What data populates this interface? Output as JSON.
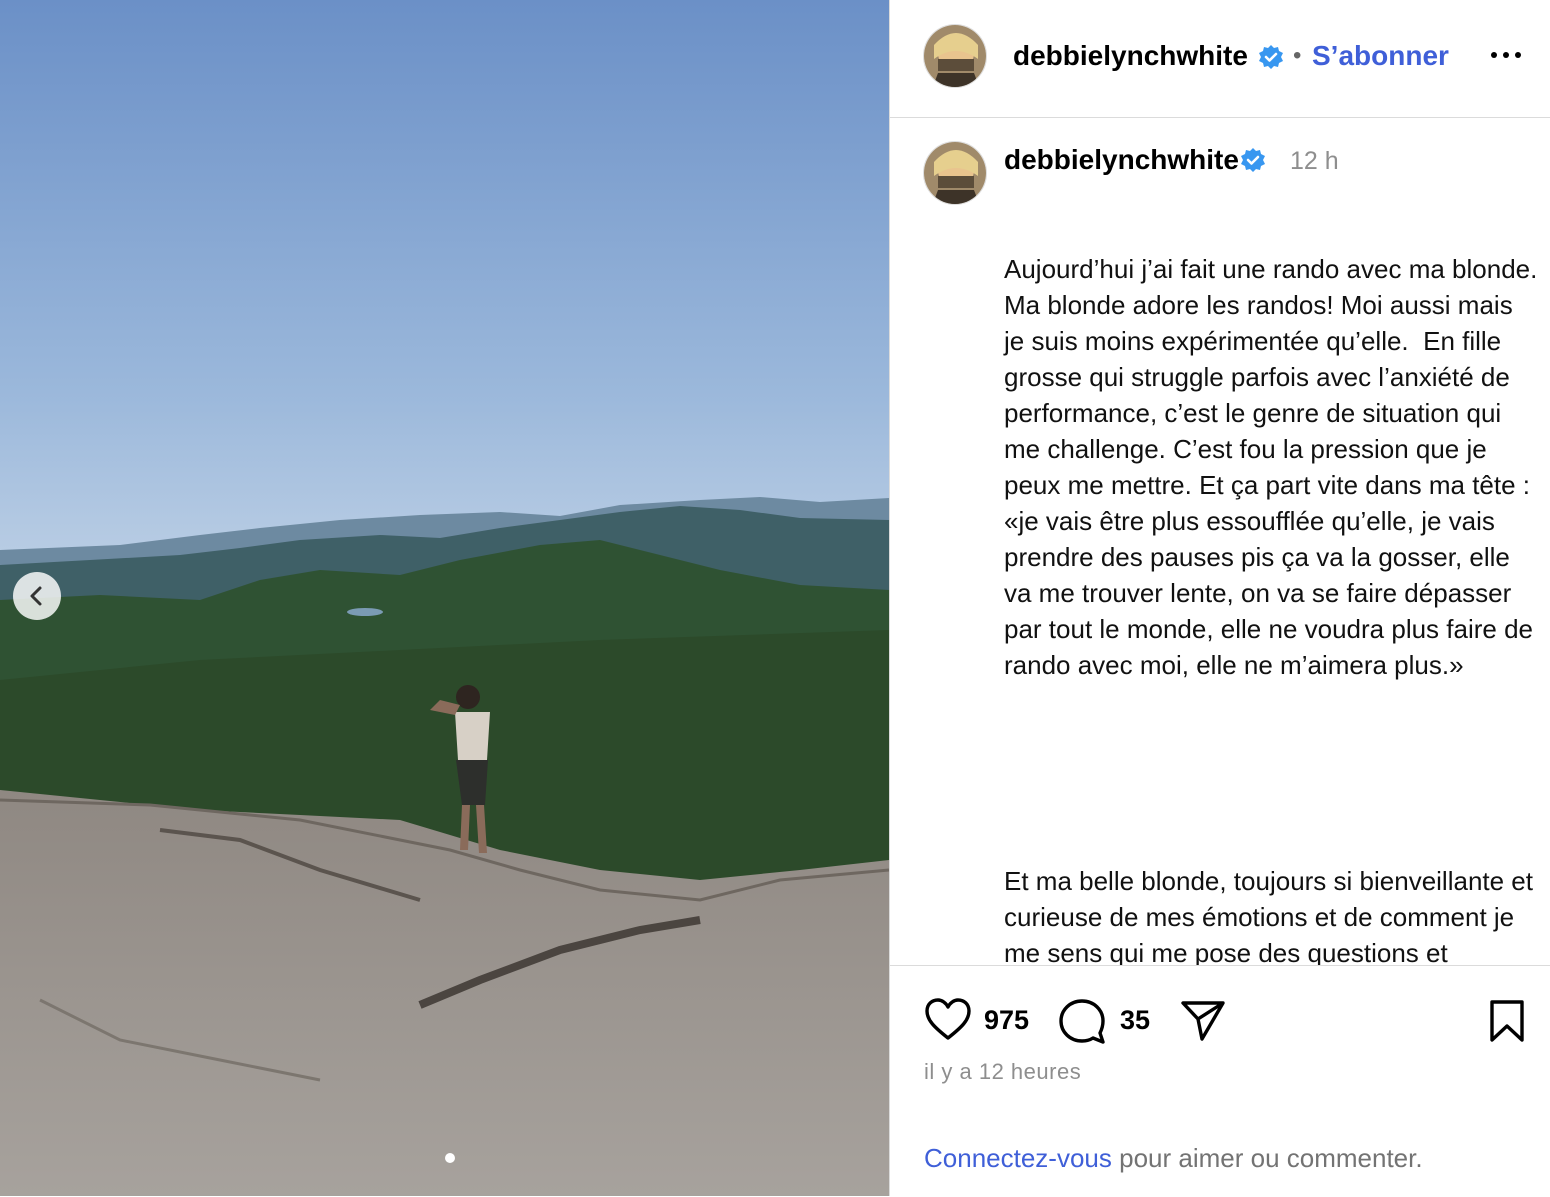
{
  "post": {
    "username": "debbielynchwhite",
    "follow_label": "S’abonner",
    "separator": "•",
    "time_short": "12 h",
    "caption_p1": "Aujourd’hui j’ai fait une rando avec ma blonde. Ma blonde adore les randos! Moi aussi mais je suis moins expérimentée qu’elle.  En fille grosse qui struggle parfois avec l’anxiété de performance, c’est le genre de situation qui me challenge. C’est fou la pression que je peux me mettre. Et ça part vite dans ma tête : «je vais être plus essoufflée qu’elle, je vais prendre des pauses pis ça va la gosser, elle va me trouver lente, on va se faire dépasser par tout le monde, elle ne voudra plus faire de rando avec moi, elle ne m’aimera plus.»",
    "caption_p2": "Et ma belle blonde, toujours si bienveillante et curieuse de mes émotions et de comment je me sens qui me pose des questions et cherche à comprendre ce qui se passe en moi. Et tous ses mots pleins d’amour et de douceur : «Je comprends tellement",
    "likes": "975",
    "comments": "35",
    "time_ago": "il y a 12 heures",
    "login_link": "Connectez-vous",
    "login_rest": " pour aimer ou commenter."
  },
  "icons": {
    "verified": "verified-badge-icon",
    "more": "more-options-icon",
    "like": "heart-icon",
    "comment": "comment-icon",
    "share": "share-icon",
    "save": "bookmark-icon",
    "prev": "chevron-left-icon"
  },
  "colors": {
    "verified_blue": "#3897f0",
    "link_blue": "#3f5fd8",
    "muted": "#8e8e8e"
  }
}
